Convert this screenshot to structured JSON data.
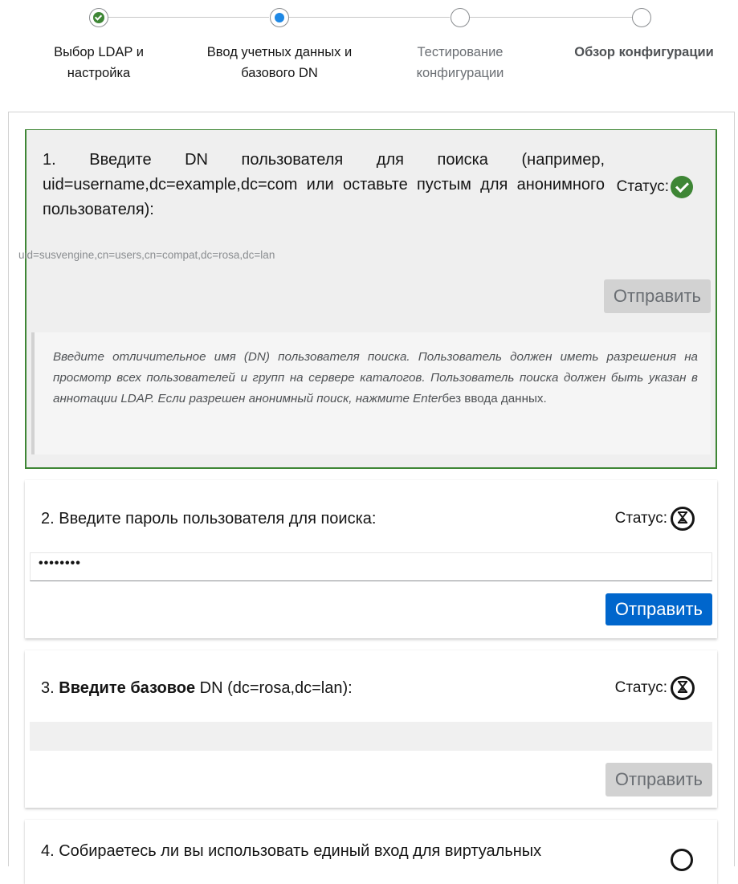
{
  "wizard": {
    "steps": [
      {
        "label_line1": "Выбор LDAP и",
        "label_line2": "настройка",
        "state": "done"
      },
      {
        "label_line1": "Ввод учетных данных и",
        "label_line2": "базового DN",
        "state": "current"
      },
      {
        "label_line1": "Тестирование",
        "label_line2": "конфигурации",
        "state": "pending"
      },
      {
        "label_line1": "Обзор конфигурации",
        "label_line2": "",
        "state": "pending"
      }
    ]
  },
  "cards": {
    "q1": {
      "title": "1. Введите DN пользователя для поиска (например, uid=username,dc=example,dc=com или оставьте пустым для анонимного пользователя):",
      "status_label": "Статус:",
      "status_icon": "check-circle-icon",
      "value": "uid=susvengine,cn=users,cn=compat,dc=rosa,dc=lan",
      "submit_label": "Отправить",
      "help_italic": "Введите отличительное имя (DN) пользователя поиска. Пользователь должен иметь разрешения на просмотр всех пользователей и групп на сервере каталогов. Пользователь поиска должен быть указан в аннотации LDAP. Если разрешен анонимный поиск, нажмите Enter",
      "help_plain": "без ввода данных."
    },
    "q2": {
      "title": "2. Введите пароль пользователя для поиска:",
      "status_label": "Статус:",
      "status_icon": "hourglass-icon",
      "password_value": "••••••••",
      "submit_label": "Отправить"
    },
    "q3": {
      "title_prefix": "3. ",
      "title_bold": "Введите базовое",
      "title_rest": " DN (dc=rosa,dc=lan):",
      "status_label": "Статус:",
      "status_icon": "hourglass-icon",
      "submit_label": "Отправить"
    },
    "q4": {
      "title": "4. Собираетесь ли вы использовать единый вход для виртуальных"
    }
  },
  "colors": {
    "success": "#3e8635",
    "current": "#1e88e5",
    "primary_button": "#0066cc",
    "disabled_button": "#d2d2d2"
  }
}
